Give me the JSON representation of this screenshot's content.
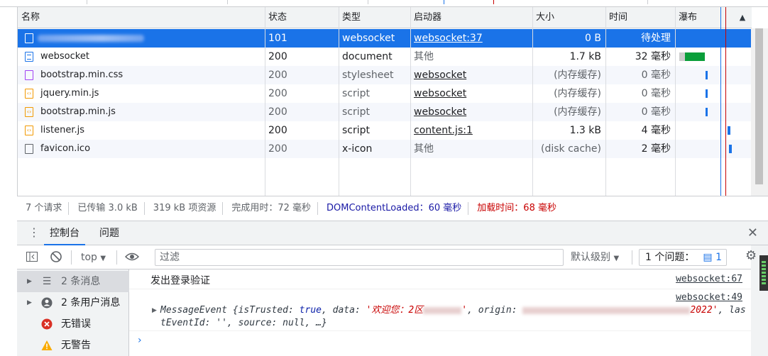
{
  "network": {
    "columns": {
      "name": "名称",
      "status": "状态",
      "type": "类型",
      "initiator": "启动器",
      "size": "大小",
      "time": "时间",
      "waterfall": "瀑布"
    },
    "rows": [
      {
        "name": "",
        "status": "101",
        "type": "websocket",
        "initiator": "websocket:37",
        "size": "0 B",
        "time": "待处理",
        "icon": "websocket-icon"
      },
      {
        "name": "websocket",
        "status": "200",
        "type": "document",
        "initiator": "其他",
        "size": "1.7 kB",
        "time": "32 毫秒",
        "icon": "document-icon"
      },
      {
        "name": "bootstrap.min.css",
        "status": "200",
        "type": "stylesheet",
        "initiator": "websocket",
        "size": "(内存缓存)",
        "time": "0 毫秒",
        "icon": "stylesheet-icon"
      },
      {
        "name": "jquery.min.js",
        "status": "200",
        "type": "script",
        "initiator": "websocket",
        "size": "(内存缓存)",
        "time": "0 毫秒",
        "icon": "script-icon"
      },
      {
        "name": "bootstrap.min.js",
        "status": "200",
        "type": "script",
        "initiator": "websocket",
        "size": "(内存缓存)",
        "time": "0 毫秒",
        "icon": "script-icon"
      },
      {
        "name": "listener.js",
        "status": "200",
        "type": "script",
        "initiator": "content.js:1",
        "size": "1.3 kB",
        "time": "4 毫秒",
        "icon": "script-icon"
      },
      {
        "name": "favicon.ico",
        "status": "200",
        "type": "x-icon",
        "initiator": "其他",
        "size": "(disk cache)",
        "time": "2 毫秒",
        "icon": "file-icon"
      }
    ]
  },
  "status_bar": {
    "requests": "7 个请求",
    "transferred": "已传输 3.0 kB",
    "resources": "319 kB 项资源",
    "finish": "完成用时：72 毫秒",
    "dom_content_loaded": "DOMContentLoaded：60 毫秒",
    "load": "加载时间：68 毫秒"
  },
  "drawer": {
    "tabs": [
      "控制台",
      "问题"
    ]
  },
  "console_toolbar": {
    "context": "top",
    "filter_placeholder": "过滤",
    "levels": "默认级别",
    "issues_label": "1 个问题：",
    "issues_count": "1"
  },
  "console_sidebar": {
    "items": [
      {
        "label": "2 条消息",
        "icon": "list-icon"
      },
      {
        "label": "2 条用户消息",
        "icon": "user-icon"
      },
      {
        "label": "无错误",
        "icon": "error-icon"
      },
      {
        "label": "无警告",
        "icon": "warning-icon"
      }
    ]
  },
  "console_messages": [
    {
      "text": "发出登录验证",
      "source": "websocket:67"
    },
    {
      "source": "websocket:49",
      "prefix": "MessageEvent {isTrusted: ",
      "is_trusted": "true",
      "data_key": ", data: ",
      "data_value": "'欢迎您：2区",
      "data_end": "'",
      "origin_key": ", origin: ",
      "origin_end": "2022'",
      "tail": ", lastEventId: '', source: null, …}"
    }
  ],
  "colors": {
    "selected_row": "#1a73e8",
    "dom_content_loaded": "#1a1aa6",
    "load": "#c80000",
    "waterfall_bar": "#0a9e3a"
  }
}
